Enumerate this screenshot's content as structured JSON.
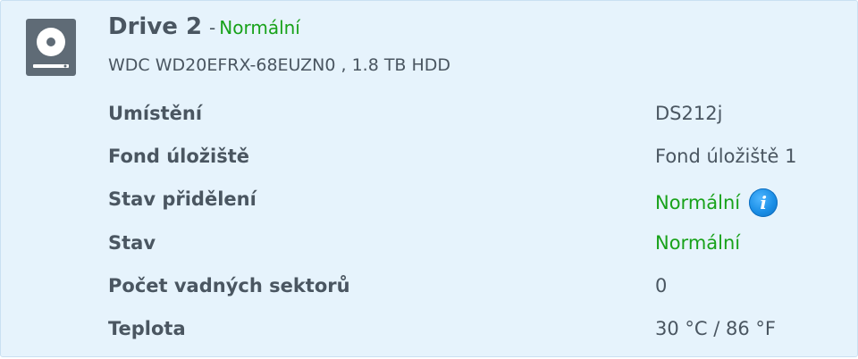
{
  "drive": {
    "title": "Drive 2",
    "separator": "-",
    "status": "Normální",
    "model": "WDC WD20EFRX-68EUZN0 , 1.8 TB HDD",
    "icon": "hard-drive-icon"
  },
  "details": [
    {
      "label": "Umístění",
      "value": "DS212j"
    },
    {
      "label": "Fond úložiště",
      "value": "Fond úložiště 1"
    },
    {
      "label": "Stav přidělení",
      "value": "Normální"
    },
    {
      "label": "Stav",
      "value": "Normální"
    },
    {
      "label": "Počet vadných sektorů",
      "value": "0"
    },
    {
      "label": "Teplota",
      "value": "30 °C / 86 °F"
    }
  ],
  "info_icon": {
    "glyph": "i",
    "name": "info-icon"
  },
  "colors": {
    "panel_bg": "#e6f3fc",
    "text": "#4a5661",
    "status_ok": "#18a21a",
    "info_blue": "#1a8ee6"
  }
}
